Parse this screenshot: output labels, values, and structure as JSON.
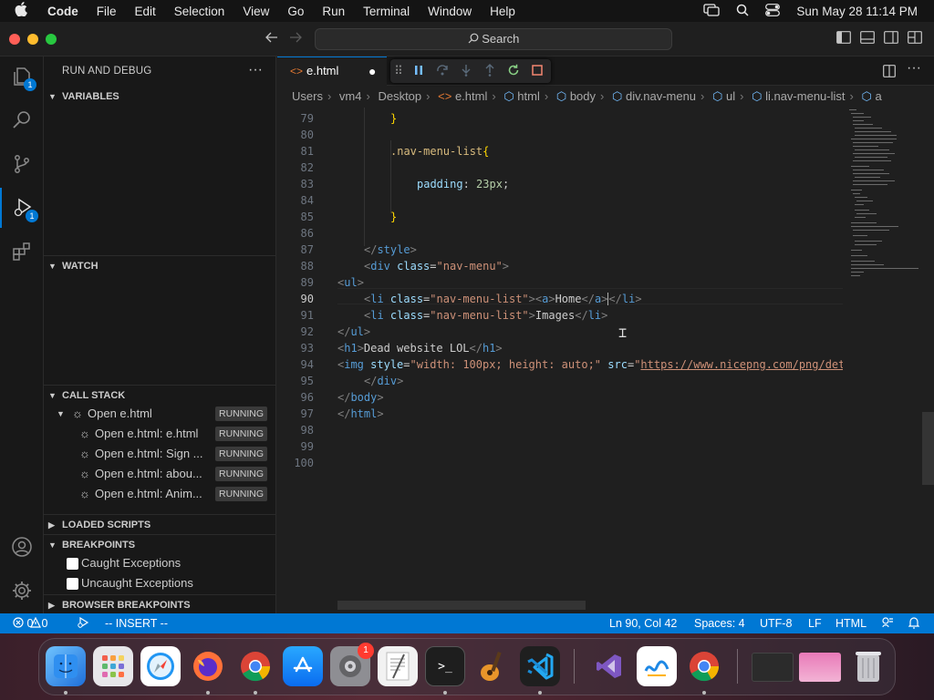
{
  "menubar": {
    "app": "Code",
    "items": [
      "File",
      "Edit",
      "Selection",
      "View",
      "Go",
      "Run",
      "Terminal",
      "Window",
      "Help"
    ],
    "datetime": "Sun May 28  11:14 PM"
  },
  "titlebar": {
    "search_label": "Search"
  },
  "activity": {
    "explorer_badge": "1",
    "debug_badge": "1"
  },
  "sidebar": {
    "title": "RUN AND DEBUG",
    "sections": {
      "variables": "VARIABLES",
      "watch": "WATCH",
      "call_stack": "CALL STACK",
      "loaded_scripts": "LOADED SCRIPTS",
      "breakpoints": "BREAKPOINTS",
      "browser_breakpoints": "BROWSER BREAKPOINTS"
    },
    "call_stack": [
      {
        "label": "Open e.html",
        "status": "RUNNING"
      },
      {
        "label": "Open e.html: e.html",
        "status": "RUNNING"
      },
      {
        "label": "Open e.html: Sign ...",
        "status": "RUNNING"
      },
      {
        "label": "Open e.html: abou...",
        "status": "RUNNING"
      },
      {
        "label": "Open e.html: Anim...",
        "status": "RUNNING"
      }
    ],
    "breakpoints": [
      {
        "label": "Caught Exceptions"
      },
      {
        "label": "Uncaught Exceptions"
      }
    ]
  },
  "editor": {
    "tab_label": "e.html",
    "breadcrumb": [
      "Users",
      "vm4",
      "Desktop",
      "e.html",
      "html",
      "body",
      "div.nav-menu",
      "ul",
      "li.nav-menu-list",
      "a"
    ],
    "line_numbers": [
      "79",
      "80",
      "81",
      "82",
      "83",
      "84",
      "85",
      "86",
      "87",
      "88",
      "89",
      "90",
      "91",
      "92",
      "93",
      "94",
      "95",
      "96",
      "97",
      "98",
      "99",
      "100"
    ],
    "current_line": "90",
    "code": {
      "l79": "}",
      "l81_sel": ".nav-menu-list",
      "l81_brace": "{",
      "l83_prop": "padding",
      "l83_val": "23px",
      "l85": "}",
      "l87": "style",
      "l88_tag": "div",
      "l88_attr": "class",
      "l88_val": "\"nav-menu\"",
      "l89": "ul",
      "l90_tag": "li",
      "l90_attr": "class",
      "l90_val": "\"nav-menu-list\"",
      "l90_a": "a",
      "l90_text": "Home",
      "l91_text": "Images",
      "l93_tag": "h1",
      "l93_text": "Dead website LOL",
      "l94_tag": "img",
      "l94_attr1": "style",
      "l94_val1": "\"width: 100px; height: auto;\"",
      "l94_attr2": "src",
      "l94_val2": "https://www.nicepng.com/png/det",
      "l95": "div",
      "l96": "body",
      "l97": "html"
    }
  },
  "statusbar": {
    "errors": "0",
    "warnings": "0",
    "mode": "-- INSERT --",
    "position": "Ln 90, Col 42",
    "spaces": "Spaces: 4",
    "encoding": "UTF-8",
    "eol": "LF",
    "language": "HTML"
  },
  "dock": {
    "settings_badge": "1"
  }
}
